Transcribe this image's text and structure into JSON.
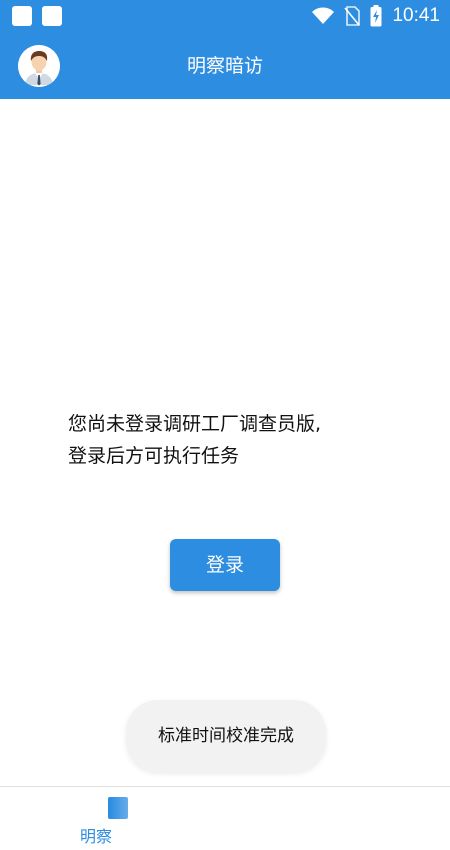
{
  "status_bar": {
    "time": "10:41",
    "icons": [
      "notification-square-icon",
      "notification-square-icon",
      "wifi-icon",
      "no-sim-icon",
      "battery-charging-icon"
    ]
  },
  "app_bar": {
    "title": "明察暗访",
    "avatar_icon": "user-avatar-icon"
  },
  "main": {
    "message_line1": "您尚未登录调研工厂调查员版,",
    "message_line2": "登录后方可执行任务",
    "login_label": "登录"
  },
  "bottom_nav": {
    "items": [
      {
        "label": "明察",
        "icon": "nav-tab-icon"
      }
    ]
  },
  "toast": {
    "text": "标准时间校准完成"
  },
  "colors": {
    "primary": "#2d8de0",
    "background": "#ffffff",
    "toast_bg": "#f2f2f2"
  }
}
